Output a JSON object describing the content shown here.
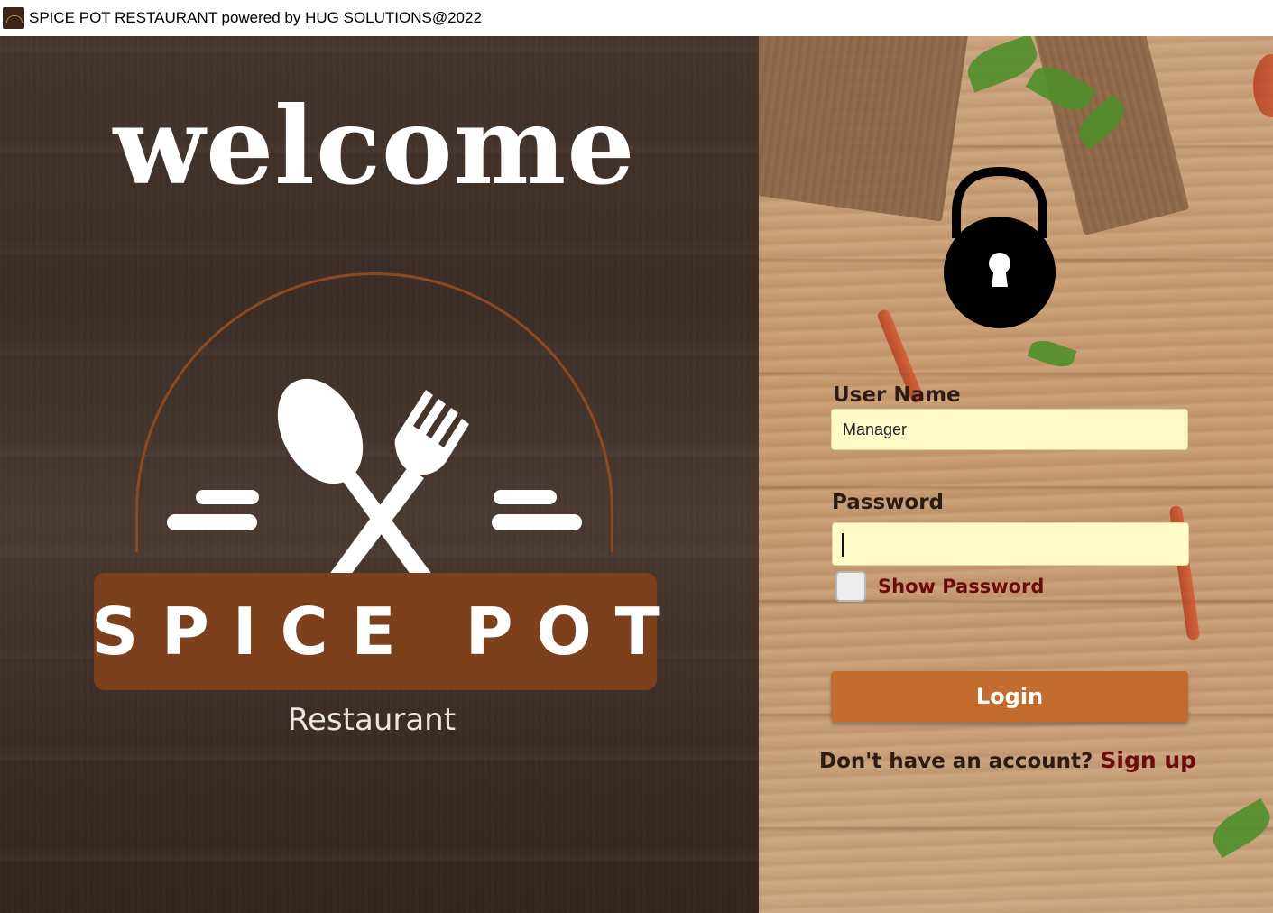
{
  "window": {
    "title": "SPICE POT RESTAURANT powered by HUG SOLUTIONS@2022",
    "icon": "app-logo-icon"
  },
  "left": {
    "welcome": "welcome",
    "logo": {
      "name": "SPICE POT",
      "subtitle": "Restaurant",
      "colors": {
        "banner": "#7c401d",
        "arc": "#8b4a22"
      }
    }
  },
  "login": {
    "lock_icon": "lock-icon",
    "username_label": "User Name",
    "username_value": "Manager",
    "password_label": "Password",
    "password_value": "",
    "show_password_label": "Show Password",
    "show_password_checked": false,
    "login_label": "Login",
    "no_account_text": "Don't have an account?",
    "signup_label": "Sign up",
    "colors": {
      "input_bg": "#fffbc8",
      "button": "#c46b2e",
      "link": "#6b0b0b"
    }
  }
}
